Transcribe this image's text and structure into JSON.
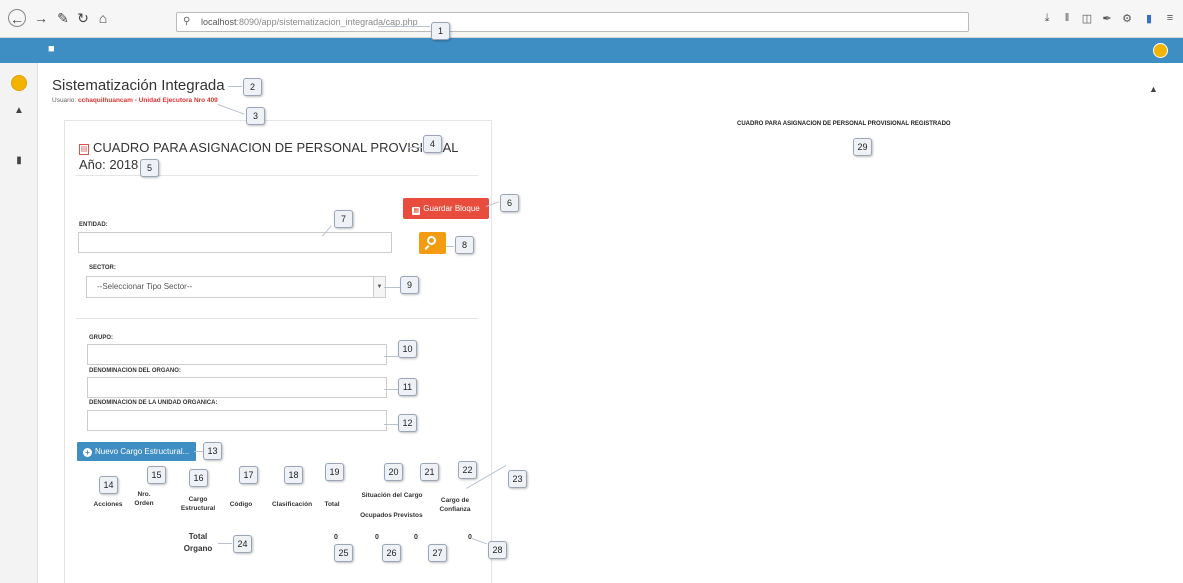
{
  "browser": {
    "url_host": "localhost",
    "url_path": ":8090/app/sistematizacion_integrada/cap.php"
  },
  "app": {
    "title": "Sistematización Integrada",
    "user_prefix": "Usuario: ",
    "user_value": "cchaquilhuancam - Unidad Ejecutora Nro 409"
  },
  "form": {
    "title": "CUADRO PARA ASIGNACION DE PERSONAL PROVISIONAL",
    "year_label": "Año: 2018",
    "save_button": "Guardar Bloque",
    "entidad_label": "ENTIDAD:",
    "entidad_value": "",
    "sector_label": "SECTOR:",
    "sector_selected": "--Seleccionar Tipo Sector--",
    "grupo_label": "GRUPO:",
    "grupo_value": "",
    "organo_label": "DENOMINACION DEL ORGANO:",
    "organo_value": "",
    "unidad_label": "DENOMINACION DE LA UNIDAD ORGANICA:",
    "unidad_value": "",
    "new_button": "Nuevo Cargo Estructural..."
  },
  "table": {
    "headers": {
      "acciones": "Acciones",
      "nro_orden": "Nro. Orden",
      "cargo_estructural": "Cargo Estructural",
      "codigo": "Código",
      "clasificacion": "Clasificación",
      "total": "Total",
      "situacion": "Situación del Cargo",
      "ocupados": "Ocupados",
      "previstos": "Previstos",
      "confianza": "Cargo de Confianza"
    },
    "total_label": "Total Organo",
    "totals": [
      "0",
      "0",
      "0",
      "0"
    ]
  },
  "right_panel": {
    "heading": "CUADRO PARA ASIGNACION DE PERSONAL PROVISIONAL REGISTRADO"
  },
  "markers": [
    "1",
    "2",
    "3",
    "4",
    "5",
    "6",
    "7",
    "8",
    "9",
    "10",
    "11",
    "12",
    "13",
    "14",
    "15",
    "16",
    "17",
    "18",
    "19",
    "20",
    "21",
    "22",
    "23",
    "24",
    "25",
    "26",
    "27",
    "28",
    "29"
  ],
  "icons": [
    "back-icon",
    "forward-icon",
    "wrench-icon",
    "reload-icon",
    "home-icon",
    "search-icon",
    "download-icon",
    "library-icon",
    "sidebar-icon",
    "brush-icon",
    "extension-icon",
    "bookmark-icon",
    "menu-icon",
    "hamburger-icon",
    "avatar-icon",
    "dashboard-icon",
    "document-icon",
    "pdf-icon",
    "save-icon",
    "magnifier-icon",
    "chevron-down-icon",
    "plus-icon"
  ]
}
